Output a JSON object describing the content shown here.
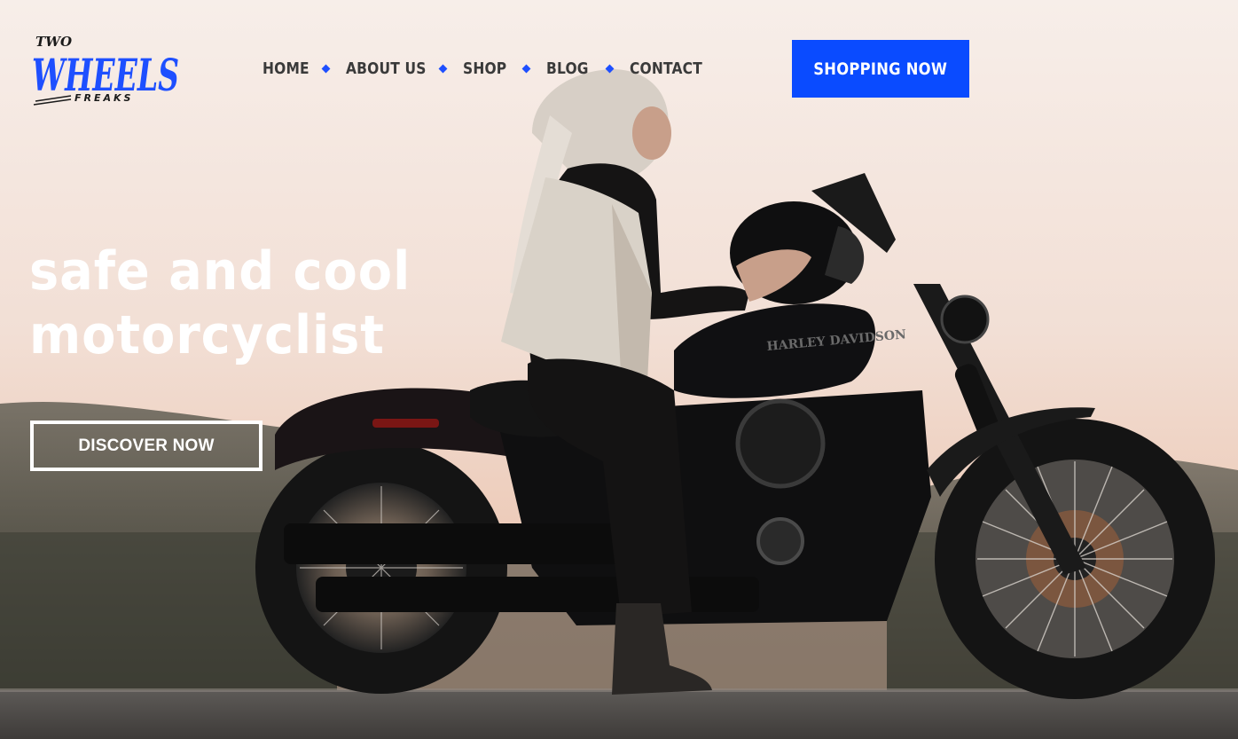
{
  "brand": {
    "top": "TWO",
    "main": "WHEELS",
    "sub": "FREAKS",
    "color": "#1e4fff"
  },
  "nav": {
    "items": [
      {
        "label": "HOME"
      },
      {
        "label": "ABOUT US"
      },
      {
        "label": "SHOP"
      },
      {
        "label": "BLOG"
      },
      {
        "label": "CONTACT"
      }
    ],
    "separator_color": "#1e4fff"
  },
  "cta": {
    "label": "SHOPPING NOW",
    "color": "#0a4bff"
  },
  "hero": {
    "headline_line1": "safe and cool",
    "headline_line2": "motorcyclist",
    "button_label": "DISCOVER NOW"
  },
  "photo": {
    "bike_tank_brand": "HARLEY DAVIDSON"
  }
}
